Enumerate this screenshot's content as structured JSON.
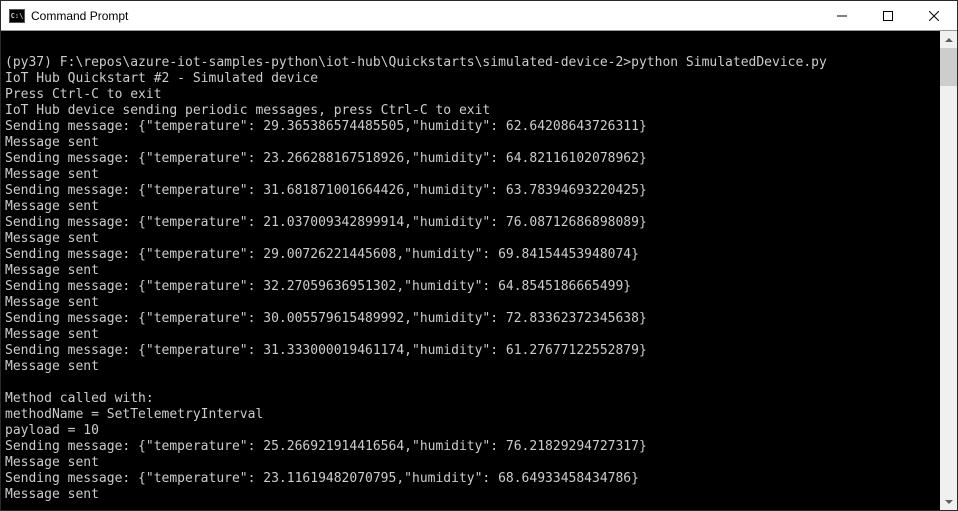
{
  "window": {
    "title": "Command Prompt",
    "icon_label": "C:\\"
  },
  "terminal": {
    "prompt": {
      "env": "(py37)",
      "path": "F:\\repos\\azure-iot-samples-python\\iot-hub\\Quickstarts\\simulated-device-2>",
      "command": "python SimulatedDevice.py"
    },
    "header_lines": [
      "IoT Hub Quickstart #2 - Simulated device",
      "Press Ctrl-C to exit",
      "IoT Hub device sending periodic messages, press Ctrl-C to exit"
    ],
    "messages": [
      {
        "temperature": "29.365386574485505",
        "humidity": "62.64208643726311"
      },
      {
        "temperature": "23.266288167518926",
        "humidity": "64.82116102078962"
      },
      {
        "temperature": "31.681871001664426",
        "humidity": "63.78394693220425"
      },
      {
        "temperature": "21.037009342899914",
        "humidity": "76.08712686898089"
      },
      {
        "temperature": "29.00726221445608",
        "humidity": "69.84154453948074"
      },
      {
        "temperature": "32.27059636951302",
        "humidity": "64.8545186665499"
      },
      {
        "temperature": "30.005579615489992",
        "humidity": "72.83362372345638"
      },
      {
        "temperature": "31.333000019461174",
        "humidity": "61.27677122552879"
      }
    ],
    "method_call": {
      "header": "Method called with:",
      "name_label": "methodName = ",
      "name_value": "SetTelemetryInterval",
      "payload_label": "payload = ",
      "payload_value": "10"
    },
    "messages_after": [
      {
        "temperature": "25.266921914416564",
        "humidity": "76.21829294727317"
      },
      {
        "temperature": "23.11619482070795",
        "humidity": "68.64933458434786"
      }
    ],
    "labels": {
      "sending_prefix": "Sending message: ",
      "sent": "Message sent"
    }
  }
}
